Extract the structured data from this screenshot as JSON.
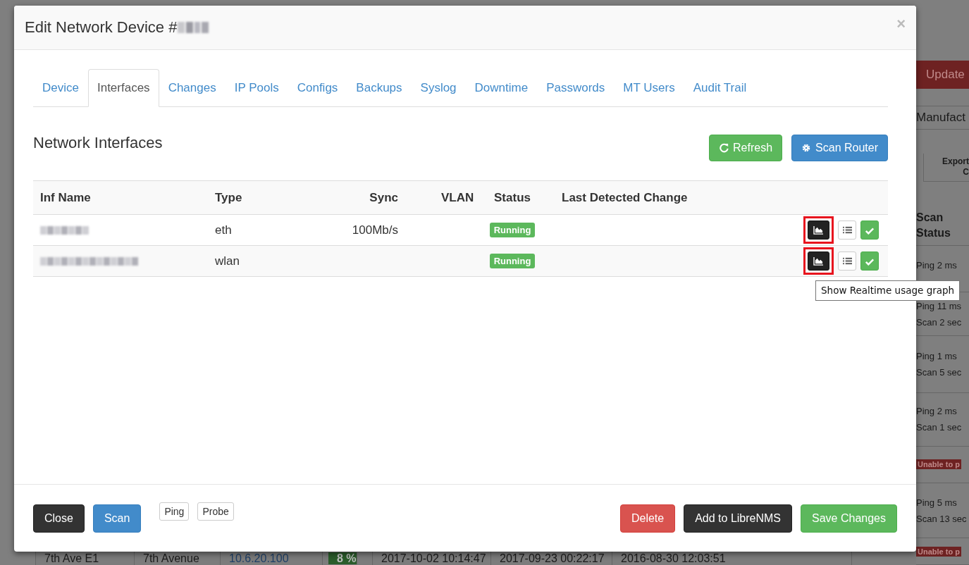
{
  "backdrop": {
    "update_button": "Update",
    "column_header": "Manufact",
    "export_header": [
      "Export",
      "C"
    ],
    "scan_header": "Scan Status",
    "rows": [
      {
        "kind": "ping",
        "lines": [
          "Ping 2 ms"
        ]
      },
      {
        "kind": "ping",
        "lines": [
          "Ping 11 ms",
          "Scan 2 sec"
        ]
      },
      {
        "kind": "ping",
        "lines": [
          "Ping 1 ms",
          "Scan 5 sec"
        ]
      },
      {
        "kind": "ping",
        "lines": [
          "Ping 2 ms",
          "Scan 1 sec"
        ]
      },
      {
        "kind": "alert",
        "lines": [
          "Unable to p"
        ]
      },
      {
        "kind": "ping",
        "lines": [
          "Ping 5 ms",
          "Scan 13 sec"
        ]
      },
      {
        "kind": "alert",
        "lines": [
          "Unable to p"
        ]
      }
    ],
    "bottom_row": [
      {
        "text": "7th Ave E1",
        "kind": "plain"
      },
      {
        "text": "7th Avenue",
        "kind": "plain"
      },
      {
        "text": "10.6.20.100",
        "kind": "link"
      },
      {
        "text": "8 %",
        "kind": "badge"
      },
      {
        "text": "2017-10-02 10:14:47",
        "kind": "plain"
      },
      {
        "text": "2017-09-23 00:22:17",
        "kind": "plain"
      },
      {
        "text": "2016-08-30 12:03:51",
        "kind": "plain"
      }
    ]
  },
  "modal": {
    "title": "Edit Network Device #",
    "close": "×",
    "tabs": [
      {
        "label": "Device",
        "selected": false
      },
      {
        "label": "Interfaces",
        "selected": true
      },
      {
        "label": "Changes",
        "selected": false
      },
      {
        "label": "IP Pools",
        "selected": false
      },
      {
        "label": "Configs",
        "selected": false
      },
      {
        "label": "Backups",
        "selected": false
      },
      {
        "label": "Syslog",
        "selected": false
      },
      {
        "label": "Downtime",
        "selected": false
      },
      {
        "label": "Passwords",
        "selected": false
      },
      {
        "label": "MT Users",
        "selected": false
      },
      {
        "label": "Audit Trail",
        "selected": false
      }
    ],
    "section_title": "Network Interfaces",
    "toolbar": [
      {
        "label": "Refresh",
        "kind": "success"
      },
      {
        "label": "Scan Router",
        "kind": "primary"
      }
    ],
    "table": {
      "columns": [
        "Inf Name",
        "Type",
        "Sync",
        "VLAN",
        "Status",
        "Last Detected Change"
      ],
      "rows": [
        {
          "type": "eth",
          "sync": "100Mb/s",
          "status": "Running",
          "highlighted": true
        },
        {
          "type": "wlan",
          "status": "Running",
          "highlighted": true
        }
      ]
    },
    "tooltip": "Show Realtime usage graph",
    "footer_left": [
      {
        "label": "Close",
        "kind": "dark"
      },
      {
        "label": "Scan",
        "kind": "primary"
      },
      {
        "label": "Ping",
        "kind": "small"
      },
      {
        "label": "Probe",
        "kind": "small"
      }
    ],
    "footer_right": [
      {
        "label": "Delete",
        "kind": "danger"
      },
      {
        "label": "Add to LibreNMS",
        "kind": "dark"
      },
      {
        "label": "Save Changes",
        "kind": "success"
      }
    ]
  }
}
